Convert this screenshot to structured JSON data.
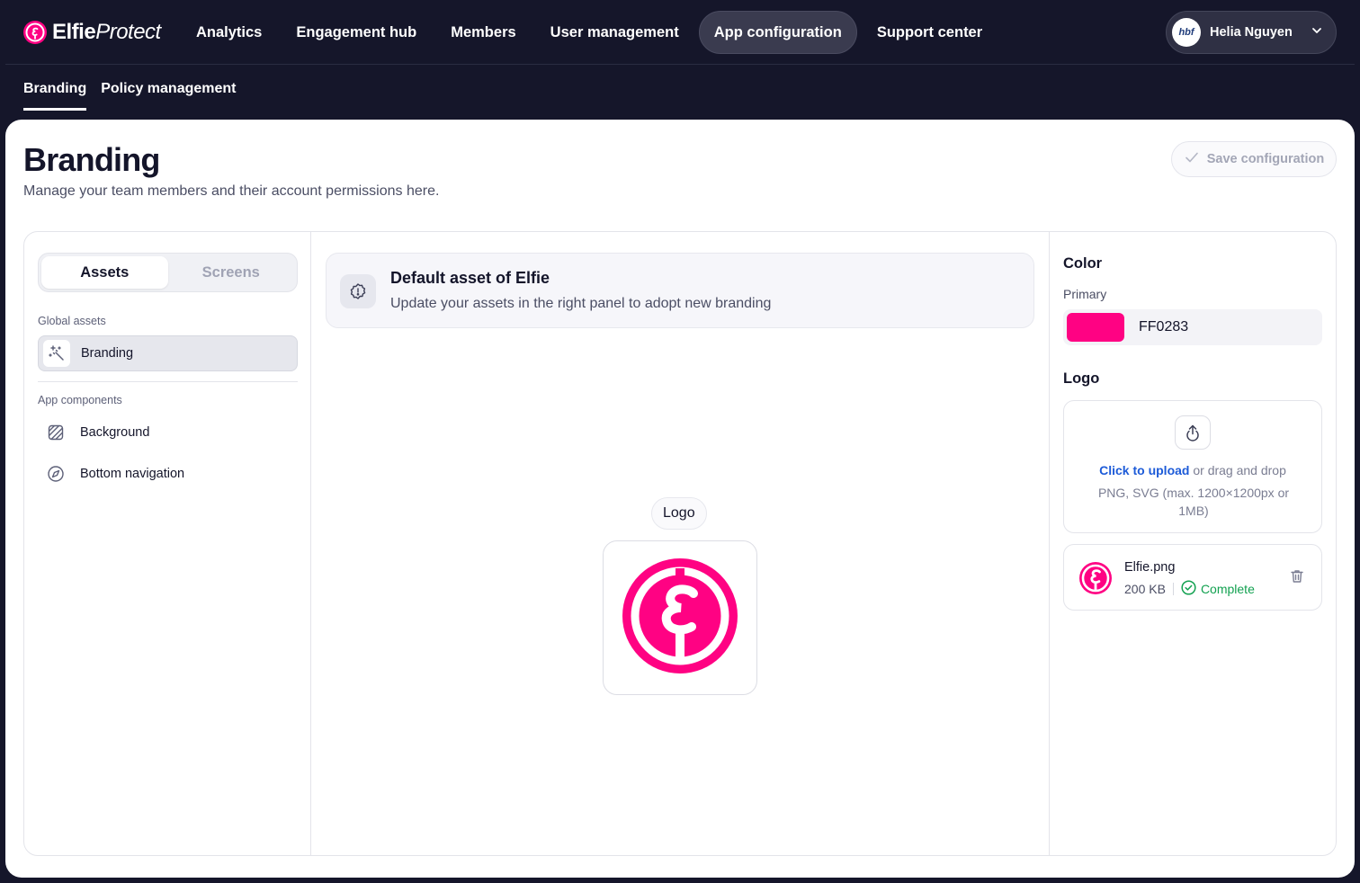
{
  "app": {
    "brand_bold": "Elfie",
    "brand_light": "Protect",
    "nav": [
      {
        "label": "Analytics"
      },
      {
        "label": "Engagement hub"
      },
      {
        "label": "Members"
      },
      {
        "label": "User management"
      },
      {
        "label": "App configuration",
        "active": true
      },
      {
        "label": "Support center"
      }
    ],
    "user": {
      "avatar_text": "hbf",
      "name": "Helia Nguyen"
    },
    "accent": "#FF0283"
  },
  "subtabs": [
    {
      "label": "Branding",
      "active": true
    },
    {
      "label": "Policy management"
    }
  ],
  "page": {
    "title": "Branding",
    "subtitle": "Manage your team members and their account permissions here.",
    "save_label": "Save configuration"
  },
  "left": {
    "segments": [
      {
        "label": "Assets",
        "active": true
      },
      {
        "label": "Screens"
      }
    ],
    "global_label": "Global assets",
    "global_items": [
      {
        "label": "Branding",
        "icon": "magic-wand-icon",
        "active": true
      }
    ],
    "components_label": "App components",
    "component_items": [
      {
        "label": "Background",
        "icon": "pattern-icon"
      },
      {
        "label": "Bottom navigation",
        "icon": "compass-icon"
      }
    ]
  },
  "middle": {
    "info_title": "Default asset of Elfie",
    "info_sub": "Update your assets in the right panel to adopt new branding",
    "logo_chip": "Logo"
  },
  "right": {
    "color_heading": "Color",
    "primary_label": "Primary",
    "primary_hex": "FF0283",
    "logo_heading": "Logo",
    "upload_link": "Click to upload",
    "upload_rest": " or drag and drop",
    "upload_hint": "PNG, SVG (max. 1200×1200px or 1MB)",
    "file": {
      "name": "Elfie.png",
      "size": "200 KB",
      "status": "Complete"
    }
  }
}
